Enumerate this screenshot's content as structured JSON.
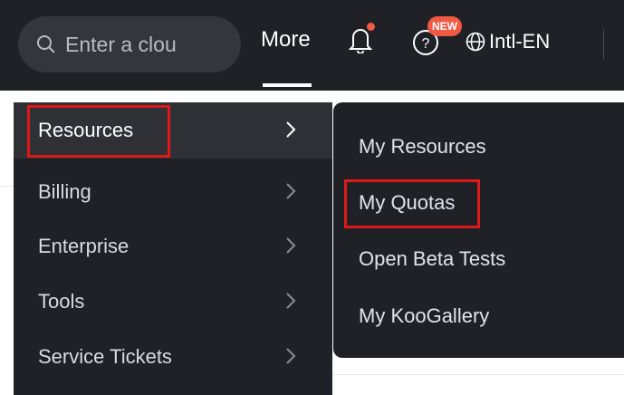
{
  "topbar": {
    "search_placeholder": "Enter a clou",
    "more_label": "More",
    "new_badge": "NEW",
    "language_label": "Intl-EN"
  },
  "menu": {
    "primary": [
      {
        "label": "Resources",
        "active": true
      },
      {
        "label": "Billing"
      },
      {
        "label": "Enterprise"
      },
      {
        "label": "Tools"
      },
      {
        "label": "Service Tickets"
      }
    ],
    "submenu": [
      {
        "label": "My Resources"
      },
      {
        "label": "My Quotas",
        "highlighted": true
      },
      {
        "label": "Open Beta Tests"
      },
      {
        "label": "My KooGallery"
      }
    ]
  },
  "colors": {
    "nav_background": "#1f2126",
    "highlight_border": "#e01818",
    "badge": "#f05a45"
  },
  "icons": [
    "search-icon",
    "bell-icon",
    "help-icon",
    "globe-icon",
    "chevron-right-icon"
  ]
}
